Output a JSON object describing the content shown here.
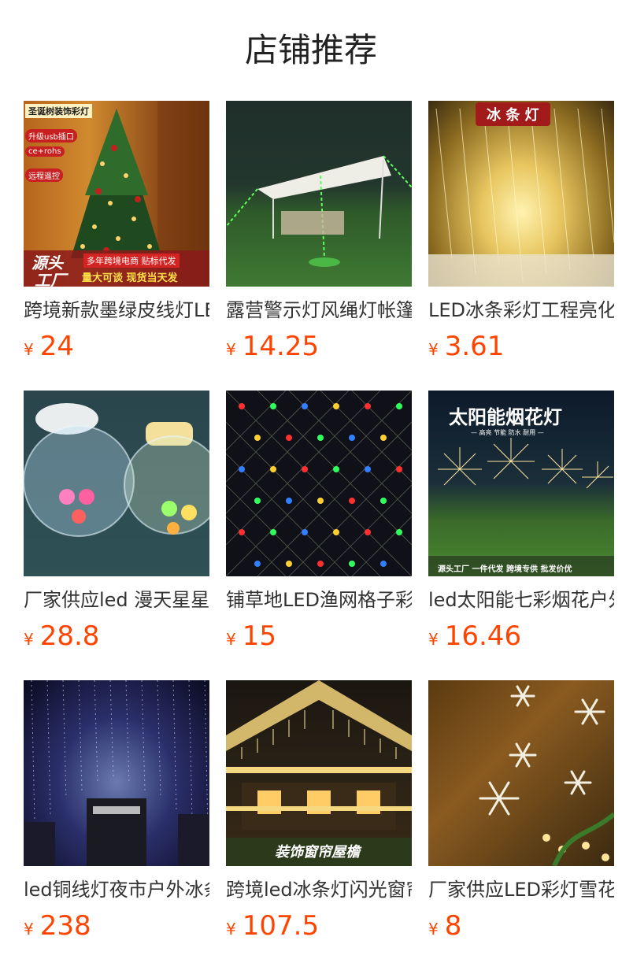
{
  "header": {
    "title": "店铺推荐"
  },
  "colors": {
    "price": "#ff4400",
    "text": "#333333"
  },
  "products": [
    {
      "name": "跨境新款墨绿皮线灯LED",
      "currency": "¥",
      "price": "24",
      "image": {
        "icon": "christmas-tree-image",
        "badges": [
          "圣诞树装饰彩灯",
          "升级usb插口",
          "ce+rohs",
          "远程遥控",
          "源头",
          "工厂",
          "多年跨境电商 贴标代发",
          "量大可谈  现货当天发"
        ]
      }
    },
    {
      "name": "露营警示灯风绳灯帐篷",
      "currency": "¥",
      "price": "14.25",
      "image": {
        "icon": "camping-tent-image",
        "badges": []
      }
    },
    {
      "name": "LED冰条彩灯工程亮化",
      "currency": "¥",
      "price": "3.61",
      "image": {
        "icon": "icicle-lights-image",
        "badges": [
          "冰 条 灯"
        ]
      }
    },
    {
      "name": "厂家供应led 漫天星星",
      "currency": "¥",
      "price": "28.8",
      "image": {
        "icon": "bubble-ball-lights-image",
        "badges": []
      }
    },
    {
      "name": "铺草地LED渔网格子彩灯",
      "currency": "¥",
      "price": "15",
      "image": {
        "icon": "net-lights-image",
        "badges": []
      }
    },
    {
      "name": "led太阳能七彩烟花户外",
      "currency": "¥",
      "price": "16.46",
      "image": {
        "icon": "solar-firework-lights-image",
        "badges": [
          "太阳能烟花灯",
          "— 高亮  节能  防水  耐用 —",
          "源头工厂  一件代发  跨境专供  批发价优"
        ]
      }
    },
    {
      "name": "led铜线灯夜市户外冰条",
      "currency": "¥",
      "price": "238",
      "image": {
        "icon": "copper-wire-lights-image",
        "badges": []
      }
    },
    {
      "name": "跨境led冰条灯闪光窗帘",
      "currency": "¥",
      "price": "107.5",
      "image": {
        "icon": "house-eave-lights-image",
        "badges": [
          "装饰窗帘屋檐"
        ]
      }
    },
    {
      "name": "厂家供应LED彩灯雪花灯",
      "currency": "¥",
      "price": "8",
      "image": {
        "icon": "snowflake-lights-image",
        "badges": []
      }
    }
  ]
}
